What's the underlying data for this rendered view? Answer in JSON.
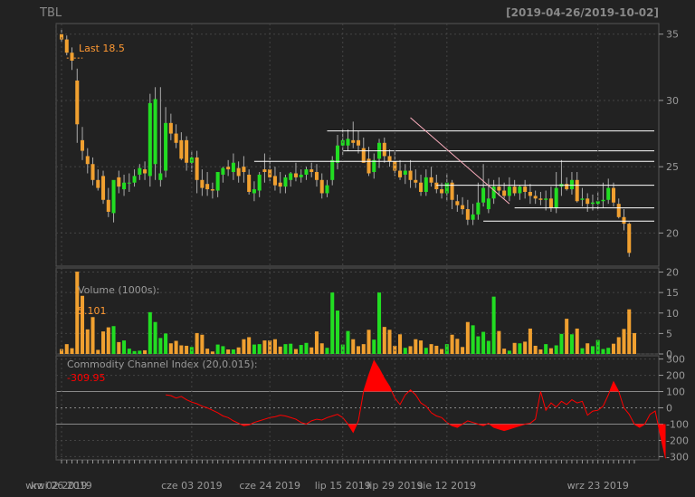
{
  "header": {
    "ticker": "TBL",
    "range": "[2019-04-26/2019-10-02]"
  },
  "colors": {
    "bg": "#222222",
    "up": "#22dd22",
    "down": "#f0a030",
    "cci": "#ff0000",
    "last": "#ff9933",
    "white": "#ffffff",
    "pink": "#ffb0c0",
    "axis": "#9a9a9a",
    "grid": "#444444"
  },
  "chart_data": [
    {
      "type": "candlestick",
      "title": "TBL",
      "last_label": "Last 18.5",
      "ylim": [
        17.5,
        35.8
      ],
      "yticks": [
        "20",
        "25",
        "30",
        "35"
      ],
      "x": [
        "2019-04-26",
        "2019-04-29",
        "2019-04-30",
        "2019-05-01",
        "2019-05-02",
        "2019-05-03",
        "2019-05-06",
        "2019-05-07",
        "2019-05-08",
        "2019-05-09",
        "2019-05-10",
        "2019-05-13",
        "2019-05-14",
        "2019-05-15",
        "2019-05-16",
        "2019-05-17",
        "2019-05-20",
        "2019-05-21",
        "2019-05-22",
        "2019-05-23",
        "2019-05-24",
        "2019-05-28",
        "2019-05-29",
        "2019-05-30",
        "2019-05-31",
        "2019-06-03",
        "2019-06-04",
        "2019-06-05",
        "2019-06-06",
        "2019-06-07",
        "2019-06-10",
        "2019-06-11",
        "2019-06-12",
        "2019-06-13",
        "2019-06-14",
        "2019-06-17",
        "2019-06-18",
        "2019-06-19",
        "2019-06-20",
        "2019-06-21",
        "2019-06-24",
        "2019-06-25",
        "2019-06-26",
        "2019-06-27",
        "2019-06-28",
        "2019-07-01",
        "2019-07-02",
        "2019-07-03",
        "2019-07-05",
        "2019-07-08",
        "2019-07-09",
        "2019-07-10",
        "2019-07-11",
        "2019-07-12",
        "2019-07-15",
        "2019-07-16",
        "2019-07-17",
        "2019-07-18",
        "2019-07-19",
        "2019-07-22",
        "2019-07-23",
        "2019-07-24",
        "2019-07-25",
        "2019-07-26",
        "2019-07-29",
        "2019-07-30",
        "2019-07-31",
        "2019-08-01",
        "2019-08-02",
        "2019-08-05",
        "2019-08-06",
        "2019-08-07",
        "2019-08-08",
        "2019-08-09",
        "2019-08-12",
        "2019-08-13",
        "2019-08-14",
        "2019-08-15",
        "2019-08-16",
        "2019-08-19",
        "2019-08-20",
        "2019-08-21",
        "2019-08-22",
        "2019-08-23",
        "2019-08-26",
        "2019-08-27",
        "2019-08-28",
        "2019-08-29",
        "2019-08-30",
        "2019-09-03",
        "2019-09-04",
        "2019-09-05",
        "2019-09-06",
        "2019-09-09",
        "2019-09-10",
        "2019-09-11",
        "2019-09-12",
        "2019-09-13",
        "2019-09-16",
        "2019-09-17",
        "2019-09-18",
        "2019-09-19",
        "2019-09-20",
        "2019-09-23",
        "2019-09-24",
        "2019-09-25",
        "2019-09-26",
        "2019-09-27",
        "2019-09-30",
        "2019-10-01",
        "2019-10-02"
      ],
      "open": [
        35.0,
        34.6,
        33.6,
        31.5,
        27.0,
        25.8,
        25.2,
        24.0,
        24.3,
        22.5,
        21.5,
        24.2,
        23.3,
        23.8,
        23.8,
        24.4,
        24.8,
        24.3,
        25.2,
        24.0,
        24.7,
        28.3,
        27.5,
        27.0,
        27.0,
        25.3,
        25.7,
        24.0,
        23.7,
        23.3,
        23.2,
        24.4,
        25.0,
        24.6,
        24.9,
        25.0,
        24.4,
        23.0,
        23.2,
        24.8,
        24.8,
        24.3,
        23.8,
        23.5,
        24.0,
        24.5,
        24.2,
        24.4,
        24.8,
        24.6,
        24.0,
        23.0,
        24.0,
        25.3,
        26.6,
        26.6,
        27.0,
        27.0,
        26.4,
        25.6,
        24.6,
        25.6,
        26.8,
        25.8,
        25.4,
        24.7,
        24.4,
        24.7,
        24.0,
        23.8,
        23.1,
        24.2,
        23.8,
        23.3,
        23.0,
        23.8,
        22.4,
        22.1,
        21.8,
        21.0,
        21.4,
        22.3,
        21.8,
        22.6,
        23.5,
        23.2,
        22.8,
        23.5,
        23.0,
        23.5,
        23.1,
        22.8,
        22.6,
        22.5,
        22.6,
        21.9,
        23.5,
        23.7,
        23.3,
        24.0,
        22.5,
        22.6,
        22.2,
        22.2,
        22.4,
        22.5,
        23.4,
        22.2,
        21.2,
        20.7
      ],
      "high": [
        35.4,
        34.9,
        34.0,
        32.4,
        28.0,
        26.4,
        25.7,
        24.8,
        24.7,
        23.4,
        22.7,
        24.7,
        24.4,
        24.5,
        24.8,
        25.2,
        25.4,
        30.5,
        31.0,
        31.0,
        29.5,
        29.0,
        28.2,
        27.6,
        27.3,
        26.2,
        26.2,
        24.8,
        24.6,
        23.8,
        24.0,
        25.0,
        25.5,
        26.0,
        25.4,
        25.8,
        24.8,
        23.9,
        24.6,
        26.0,
        25.7,
        25.0,
        24.6,
        24.4,
        24.6,
        25.3,
        24.8,
        25.0,
        25.3,
        25.2,
        24.5,
        24.0,
        25.8,
        27.4,
        27.8,
        27.8,
        28.4,
        27.7,
        27.2,
        26.5,
        26.0,
        27.1,
        27.2,
        26.3,
        26.2,
        25.5,
        25.2,
        25.5,
        24.8,
        24.4,
        24.8,
        25.0,
        24.4,
        23.8,
        24.5,
        24.0,
        22.9,
        22.7,
        22.5,
        22.2,
        23.8,
        25.2,
        24.1,
        24.0,
        24.2,
        23.8,
        24.2,
        24.0,
        23.6,
        24.0,
        23.7,
        23.2,
        23.1,
        23.2,
        23.5,
        24.6,
        25.5,
        24.2,
        24.6,
        24.6,
        23.4,
        23.0,
        22.9,
        23.1,
        23.8,
        24.1,
        23.8,
        22.6,
        21.8,
        20.8
      ],
      "low": [
        34.3,
        33.4,
        32.3,
        26.8,
        25.5,
        24.5,
        23.6,
        23.2,
        22.2,
        21.2,
        20.8,
        23.0,
        22.8,
        23.1,
        23.5,
        24.0,
        24.0,
        23.5,
        24.0,
        23.5,
        24.2,
        27.0,
        26.4,
        25.5,
        24.7,
        24.6,
        23.0,
        22.8,
        22.8,
        22.6,
        22.7,
        23.8,
        24.3,
        24.0,
        23.8,
        23.8,
        22.9,
        22.4,
        22.7,
        23.8,
        23.9,
        23.2,
        23.0,
        23.0,
        23.5,
        23.9,
        23.8,
        24.0,
        24.2,
        23.5,
        22.6,
        22.7,
        23.6,
        24.8,
        25.9,
        26.2,
        26.4,
        26.0,
        25.3,
        24.3,
        24.1,
        24.9,
        25.3,
        25.0,
        24.3,
        24.0,
        23.7,
        23.4,
        23.4,
        22.8,
        22.8,
        23.5,
        23.0,
        22.6,
        22.4,
        21.8,
        21.6,
        21.4,
        20.6,
        20.6,
        21.0,
        22.0,
        21.5,
        22.2,
        22.8,
        22.6,
        22.4,
        22.8,
        22.5,
        22.6,
        22.2,
        22.2,
        22.1,
        21.7,
        21.6,
        21.5,
        22.8,
        23.2,
        22.9,
        22.3,
        22.0,
        21.6,
        21.7,
        21.8,
        21.9,
        22.2,
        22.0,
        21.1,
        20.2,
        18.2
      ],
      "close": [
        34.6,
        33.6,
        33.0,
        28.2,
        26.2,
        25.2,
        24.0,
        23.4,
        22.5,
        21.6,
        24.0,
        23.5,
        23.8,
        23.8,
        24.3,
        24.9,
        24.5,
        29.8,
        30.1,
        24.5,
        28.3,
        27.5,
        26.8,
        25.6,
        25.3,
        25.7,
        24.0,
        23.4,
        23.3,
        23.2,
        24.6,
        24.9,
        24.8,
        25.3,
        24.3,
        24.6,
        23.1,
        23.3,
        24.4,
        24.6,
        24.2,
        23.6,
        23.5,
        24.2,
        24.5,
        24.2,
        24.4,
        24.8,
        24.6,
        24.0,
        23.0,
        23.6,
        25.5,
        26.6,
        27.0,
        27.1,
        26.8,
        26.6,
        25.3,
        24.5,
        25.5,
        26.8,
        25.8,
        25.4,
        24.7,
        24.2,
        24.7,
        24.0,
        23.8,
        23.1,
        24.2,
        23.8,
        23.3,
        23.0,
        23.8,
        22.5,
        22.1,
        21.8,
        21.0,
        21.4,
        22.3,
        23.4,
        22.6,
        23.5,
        23.2,
        22.8,
        23.5,
        23.0,
        23.5,
        23.1,
        22.8,
        22.6,
        22.5,
        22.6,
        21.9,
        23.4,
        23.7,
        23.3,
        24.0,
        22.4,
        22.6,
        22.2,
        22.3,
        22.4,
        22.5,
        23.4,
        22.3,
        21.2,
        20.7,
        18.5
      ],
      "hlines": [
        {
          "y": 27.7,
          "from": "2019-07-10",
          "to": "2019-10-02"
        },
        {
          "y": 26.2,
          "from": "2019-07-15",
          "to": "2019-10-02"
        },
        {
          "y": 25.4,
          "from": "2019-06-19",
          "to": "2019-10-02"
        },
        {
          "y": 23.6,
          "from": "2019-08-08",
          "to": "2019-10-02"
        },
        {
          "y": 21.9,
          "from": "2019-08-29",
          "to": "2019-10-02"
        },
        {
          "y": 20.9,
          "from": "2019-08-21",
          "to": "2019-10-02"
        }
      ],
      "trendline": {
        "from": {
          "x": "2019-08-01",
          "y": 28.7
        },
        "to": {
          "x": "2019-08-28",
          "y": 22.2
        }
      }
    },
    {
      "type": "bar",
      "title": "Volume (1000s):",
      "last_label": "5.101",
      "ylim": [
        0,
        21
      ],
      "yticks": [
        "0",
        "5",
        "10",
        "15",
        "20"
      ],
      "values": [
        1.2,
        2.4,
        1.4,
        20.1,
        14.2,
        6.0,
        9.0,
        1.0,
        5.5,
        6.5,
        6.8,
        2.9,
        3.3,
        1.3,
        0.7,
        0.8,
        0.9,
        10.2,
        7.8,
        3.9,
        5.0,
        2.6,
        3.2,
        2.1,
        2.0,
        1.7,
        5.1,
        4.7,
        1.3,
        0.6,
        2.3,
        1.9,
        1.1,
        1.1,
        1.6,
        3.6,
        4.1,
        2.3,
        2.4,
        3.3,
        3.3,
        3.6,
        1.8,
        2.4,
        2.5,
        1.2,
        2.2,
        2.7,
        1.6,
        5.5,
        2.6,
        1.5,
        15.0,
        10.6,
        2.3,
        5.6,
        3.6,
        1.9,
        2.4,
        5.9,
        3.5,
        15.0,
        6.6,
        5.9,
        2.0,
        4.8,
        1.5,
        1.9,
        3.6,
        3.3,
        1.5,
        2.4,
        2.0,
        1.2,
        2.4,
        4.7,
        3.7,
        1.7,
        7.8,
        7.0,
        4.3,
        5.4,
        3.2,
        14.0,
        5.6,
        1.3,
        0.8,
        2.7,
        2.6,
        3.0,
        6.2,
        2.0,
        1.1,
        2.4,
        1.4,
        2.1,
        4.9,
        8.6,
        4.8,
        6.2,
        1.4,
        2.6,
        1.9,
        3.4,
        1.2,
        1.5,
        2.5,
        4.1,
        6.1,
        10.9,
        5.1
      ]
    },
    {
      "type": "area",
      "title": "Commodity Channel Index (20,0.015):",
      "last_label": "-309.95",
      "ylim": [
        -320,
        320
      ],
      "yticks": [
        "-300",
        "-200",
        "-100",
        "0",
        "100",
        "200",
        "300"
      ],
      "start": "2019-05-24",
      "values": [
        80,
        75,
        60,
        70,
        50,
        35,
        25,
        10,
        0,
        -15,
        -30,
        -50,
        -60,
        -80,
        -95,
        -110,
        -105,
        -90,
        -80,
        -70,
        -60,
        -55,
        -45,
        -50,
        -60,
        -70,
        -90,
        -100,
        -80,
        -70,
        -75,
        -60,
        -50,
        -40,
        -60,
        -100,
        -150,
        -80,
        100,
        200,
        290,
        240,
        180,
        130,
        60,
        20,
        80,
        110,
        80,
        30,
        10,
        -30,
        -50,
        -60,
        -90,
        -110,
        -120,
        -100,
        -80,
        -90,
        -100,
        -110,
        -95,
        -120,
        -130,
        -140,
        -130,
        -120,
        -110,
        -100,
        -95,
        -70,
        100,
        -15,
        30,
        5,
        40,
        20,
        50,
        30,
        40,
        -45,
        -20,
        -15,
        10,
        80,
        160,
        100,
        0,
        -40,
        -100,
        -120,
        -100,
        -40,
        -20,
        -170,
        -310
      ]
    }
  ],
  "xaxis": {
    "ticks": [
      {
        "x": "2019-04-26",
        "label": "kwi 26 2019"
      },
      {
        "x": "2019-06-03",
        "label": "cze 03 2019"
      },
      {
        "x": "2019-06-24",
        "label": "cze 24 2019"
      },
      {
        "x": "2019-07-15",
        "label": "lip 15 2019"
      },
      {
        "x": "2019-07-29",
        "label": "lip 29 2019"
      },
      {
        "x": "2019-08-12",
        "label": "sie 12 2019"
      },
      {
        "x": "2019-09-02",
        "label": "wrz 02 2019"
      },
      {
        "x": "2019-09-23",
        "label": "wrz 23 2019"
      }
    ]
  }
}
